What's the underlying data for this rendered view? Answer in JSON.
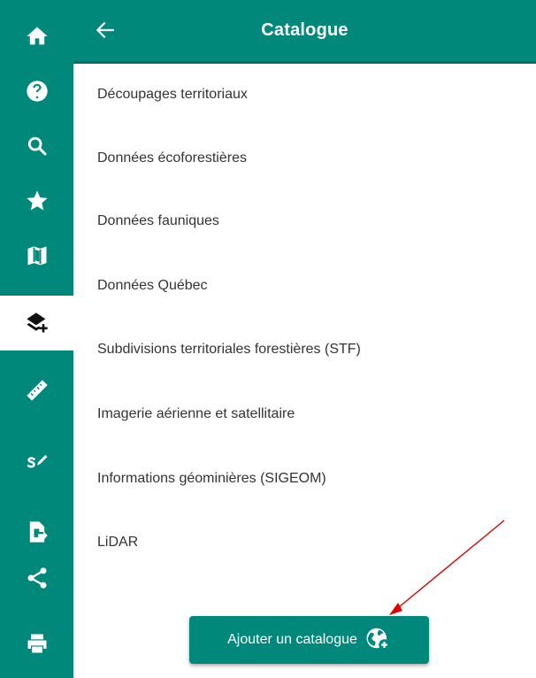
{
  "nav_rail": {
    "items": [
      {
        "icon": "home-icon"
      },
      {
        "icon": "help-icon"
      },
      {
        "icon": "search-icon"
      },
      {
        "icon": "star-icon"
      },
      {
        "icon": "map-icon"
      },
      {
        "icon": "layers-add-icon",
        "active": true
      },
      {
        "icon": "ruler-icon"
      },
      {
        "icon": "draw-icon"
      },
      {
        "icon": "file-import-icon"
      },
      {
        "icon": "share-icon"
      },
      {
        "icon": "print-icon"
      }
    ],
    "colors": {
      "background": "#00897b",
      "active_background": "#ffffff"
    }
  },
  "panel": {
    "title": "Catalogue",
    "back_icon": "arrow-left-icon",
    "items": [
      {
        "label": "Découpages territoriaux"
      },
      {
        "label": "Données écoforestières"
      },
      {
        "label": "Données fauniques"
      },
      {
        "label": "Données Québec"
      },
      {
        "label": "Subdivisions territoriales forestières (STF)"
      },
      {
        "label": "Imagerie aérienne et satellitaire"
      },
      {
        "label": "Informations géominières (SIGEOM)"
      },
      {
        "label": "LiDAR"
      }
    ],
    "add_button": {
      "label": "Ajouter un catalogue",
      "icon": "globe-add-icon"
    }
  },
  "annotation": {
    "type": "arrow",
    "color": "#e00000",
    "target": "add-catalog-button"
  }
}
